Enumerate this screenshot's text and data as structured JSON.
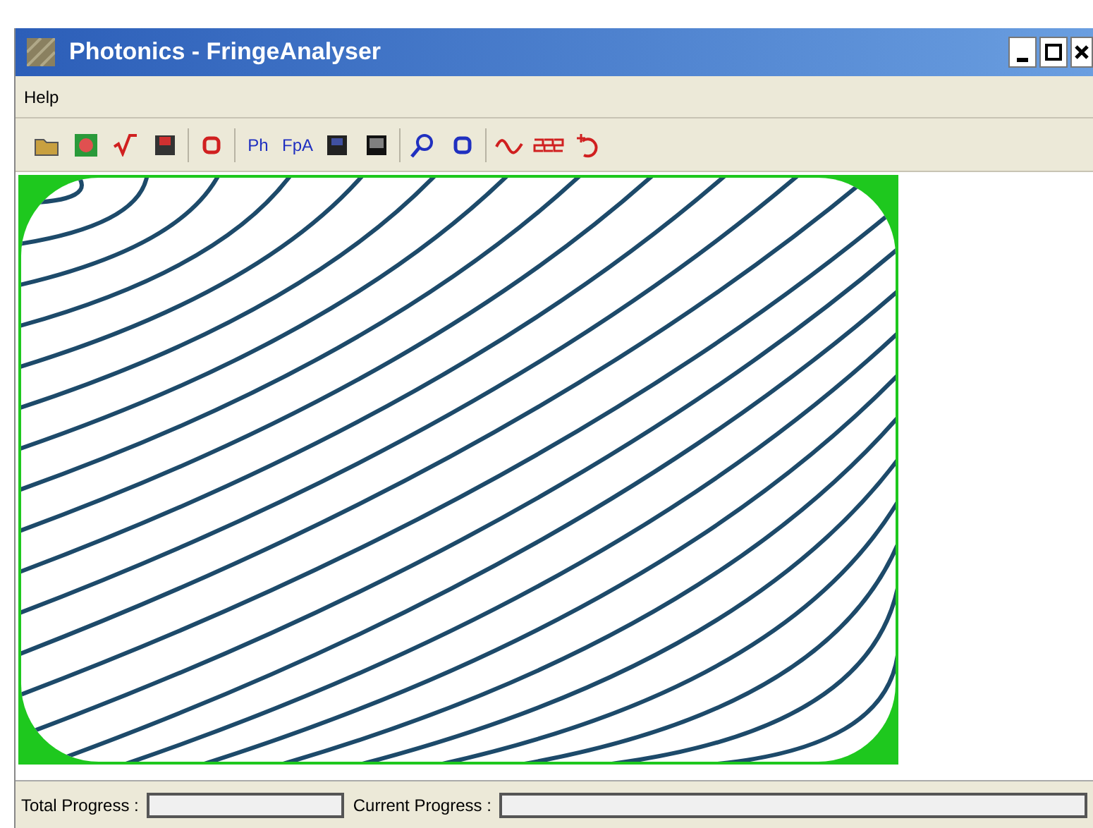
{
  "window": {
    "title": "Photonics - FringeAnalyser"
  },
  "menu": [
    {
      "label": "Help"
    }
  ],
  "toolbar": [
    [
      {
        "kind": "icon"
      },
      {
        "kind": "icon"
      },
      {
        "kind": "icon"
      },
      {
        "kind": "icon"
      }
    ],
    [
      {
        "kind": "icon"
      }
    ],
    [
      {
        "kind": "text",
        "label": "Ph"
      },
      {
        "kind": "text",
        "label": "FpA"
      },
      {
        "kind": "icon"
      },
      {
        "kind": "icon"
      }
    ],
    [
      {
        "kind": "icon"
      },
      {
        "kind": "icon"
      }
    ],
    [
      {
        "kind": "icon"
      },
      {
        "kind": "icon"
      },
      {
        "kind": "icon"
      }
    ]
  ],
  "status_bar": [
    {
      "label": "Total Progress :",
      "level": 0
    },
    {
      "label": "Current Progress :",
      "level": 0
    }
  ]
}
